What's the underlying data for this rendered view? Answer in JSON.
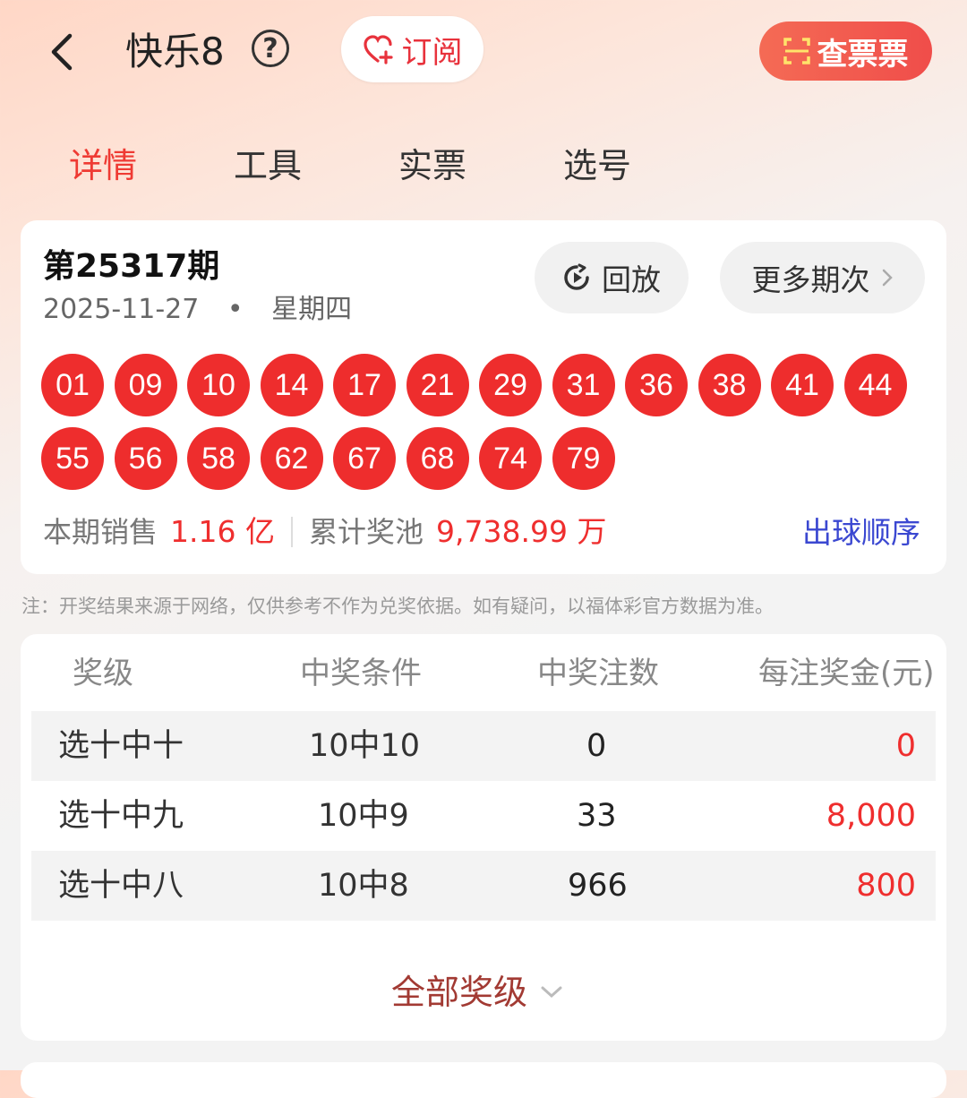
{
  "header": {
    "title": "快乐8",
    "help_icon_text": "?",
    "subscribe_label": "订阅",
    "check_ticket_label": "查票票"
  },
  "tabs": [
    {
      "label": "详情",
      "active": true
    },
    {
      "label": "工具",
      "active": false
    },
    {
      "label": "实票",
      "active": false
    },
    {
      "label": "选号",
      "active": false
    }
  ],
  "draw": {
    "issue": "第25317期",
    "date": "2025-11-27",
    "separator": "•",
    "weekday": "星期四",
    "replay_label": "回放",
    "more_label": "更多期次",
    "numbers": [
      "01",
      "09",
      "10",
      "14",
      "17",
      "21",
      "29",
      "31",
      "36",
      "38",
      "41",
      "44",
      "55",
      "56",
      "58",
      "62",
      "67",
      "68",
      "74",
      "79"
    ],
    "sales_label": "本期销售",
    "sales_value": "1.16 亿",
    "pool_label": "累计奖池",
    "pool_value": "9,738.99 万",
    "order_link": "出球顺序"
  },
  "note": "注：开奖结果来源于网络，仅供参考不作为兑奖依据。如有疑问，以福体彩官方数据为准。",
  "prize_table": {
    "headers": [
      "奖级",
      "中奖条件",
      "中奖注数",
      "每注奖金(元)"
    ],
    "rows": [
      {
        "level": "选十中十",
        "condition": "10中10",
        "count": "0",
        "amount": "0"
      },
      {
        "level": "选十中九",
        "condition": "10中9",
        "count": "33",
        "amount": "8,000"
      },
      {
        "level": "选十中八",
        "condition": "10中8",
        "count": "966",
        "amount": "800"
      }
    ],
    "all_levels_label": "全部奖级"
  },
  "colors": {
    "accent": "#ef2e2e",
    "link": "#3b48d1",
    "ball": "#ee2d2d"
  }
}
